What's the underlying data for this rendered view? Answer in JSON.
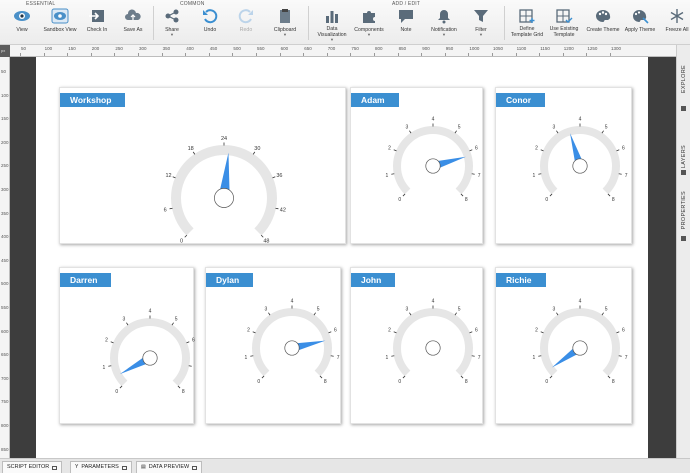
{
  "toolbar": {
    "groups": [
      {
        "label": "ESSENTIAL"
      },
      {
        "label": "COMMON"
      },
      {
        "label": "ADD / EDIT"
      }
    ],
    "buttons": [
      {
        "label": "View",
        "icon": "eye-icon"
      },
      {
        "label": "Sandbox View",
        "icon": "sandbox-eye-icon"
      },
      {
        "label": "Check In",
        "icon": "check-in-icon"
      },
      {
        "label": "Save As",
        "icon": "cloud-save-icon"
      },
      {
        "label": "Share",
        "icon": "share-icon"
      },
      {
        "label": "Undo",
        "icon": "undo-icon"
      },
      {
        "label": "Redo",
        "icon": "redo-icon"
      },
      {
        "label": "Clipboard",
        "icon": "clipboard-icon"
      },
      {
        "label": "Data\nVisualization",
        "icon": "bar-chart-icon"
      },
      {
        "label": "Components",
        "icon": "puzzle-icon"
      },
      {
        "label": "Note",
        "icon": "note-icon"
      },
      {
        "label": "Notification",
        "icon": "bell-icon"
      },
      {
        "label": "Filter",
        "icon": "funnel-icon"
      },
      {
        "label": "Define\nTemplate Grid",
        "icon": "template-grid-icon"
      },
      {
        "label": "Use Existing\nTemplate",
        "icon": "existing-template-icon"
      },
      {
        "label": "Create Theme",
        "icon": "palette-icon"
      },
      {
        "label": "Apply Theme",
        "icon": "palette-brush-icon"
      },
      {
        "label": "Freeze All",
        "icon": "snowflake-icon"
      }
    ]
  },
  "ruler": {
    "top": [
      "50",
      "100",
      "150",
      "200",
      "250",
      "300",
      "350",
      "400",
      "450",
      "500",
      "550",
      "600",
      "650",
      "700",
      "750",
      "800",
      "850",
      "900",
      "950",
      "1000",
      "1050",
      "1100",
      "1150",
      "1200",
      "1250",
      "1300"
    ],
    "left": [
      "50",
      "100",
      "150",
      "200",
      "250",
      "300",
      "350",
      "400",
      "450",
      "500",
      "550",
      "600",
      "650",
      "700",
      "750",
      "800",
      "850"
    ]
  },
  "side_tabs": [
    "EXPLORE",
    "LAYERS",
    "PROPERTIES"
  ],
  "gauges": [
    {
      "title": "Workshop",
      "ticks": [
        "0",
        "6",
        "12",
        "18",
        "24",
        "30",
        "36",
        "42",
        "48"
      ],
      "max": 48,
      "value": 25
    },
    {
      "title": "Adam",
      "ticks": [
        "0",
        "1",
        "2",
        "3",
        "4",
        "5",
        "6",
        "7",
        "8"
      ],
      "max": 8,
      "value": 6.2
    },
    {
      "title": "Conor",
      "ticks": [
        "0",
        "1",
        "2",
        "3",
        "4",
        "5",
        "6",
        "7",
        "8"
      ],
      "max": 8,
      "value": 3.5
    },
    {
      "title": "Darren",
      "ticks": [
        "0",
        "1",
        "2",
        "3",
        "4",
        "5",
        "6",
        "7",
        "8"
      ],
      "max": 8,
      "value": 0.5
    },
    {
      "title": "Dylan",
      "ticks": [
        "0",
        "1",
        "2",
        "3",
        "4",
        "5",
        "6",
        "7",
        "8"
      ],
      "max": 8,
      "value": 6.3
    },
    {
      "title": "John",
      "ticks": [
        "0",
        "1",
        "2",
        "3",
        "4",
        "5",
        "6",
        "7",
        "8"
      ],
      "max": 8,
      "value": 0
    },
    {
      "title": "Richie",
      "ticks": [
        "0",
        "1",
        "2",
        "3",
        "4",
        "5",
        "6",
        "7",
        "8"
      ],
      "max": 8,
      "value": 0.3
    }
  ],
  "bottom_tabs": [
    "SCRIPT EDITOR",
    "PARAMETERS",
    "DATA PREVIEW"
  ],
  "colors": {
    "accent": "#3b8fd1",
    "needle": "#3a8ee6",
    "track": "#e6e6e6"
  }
}
